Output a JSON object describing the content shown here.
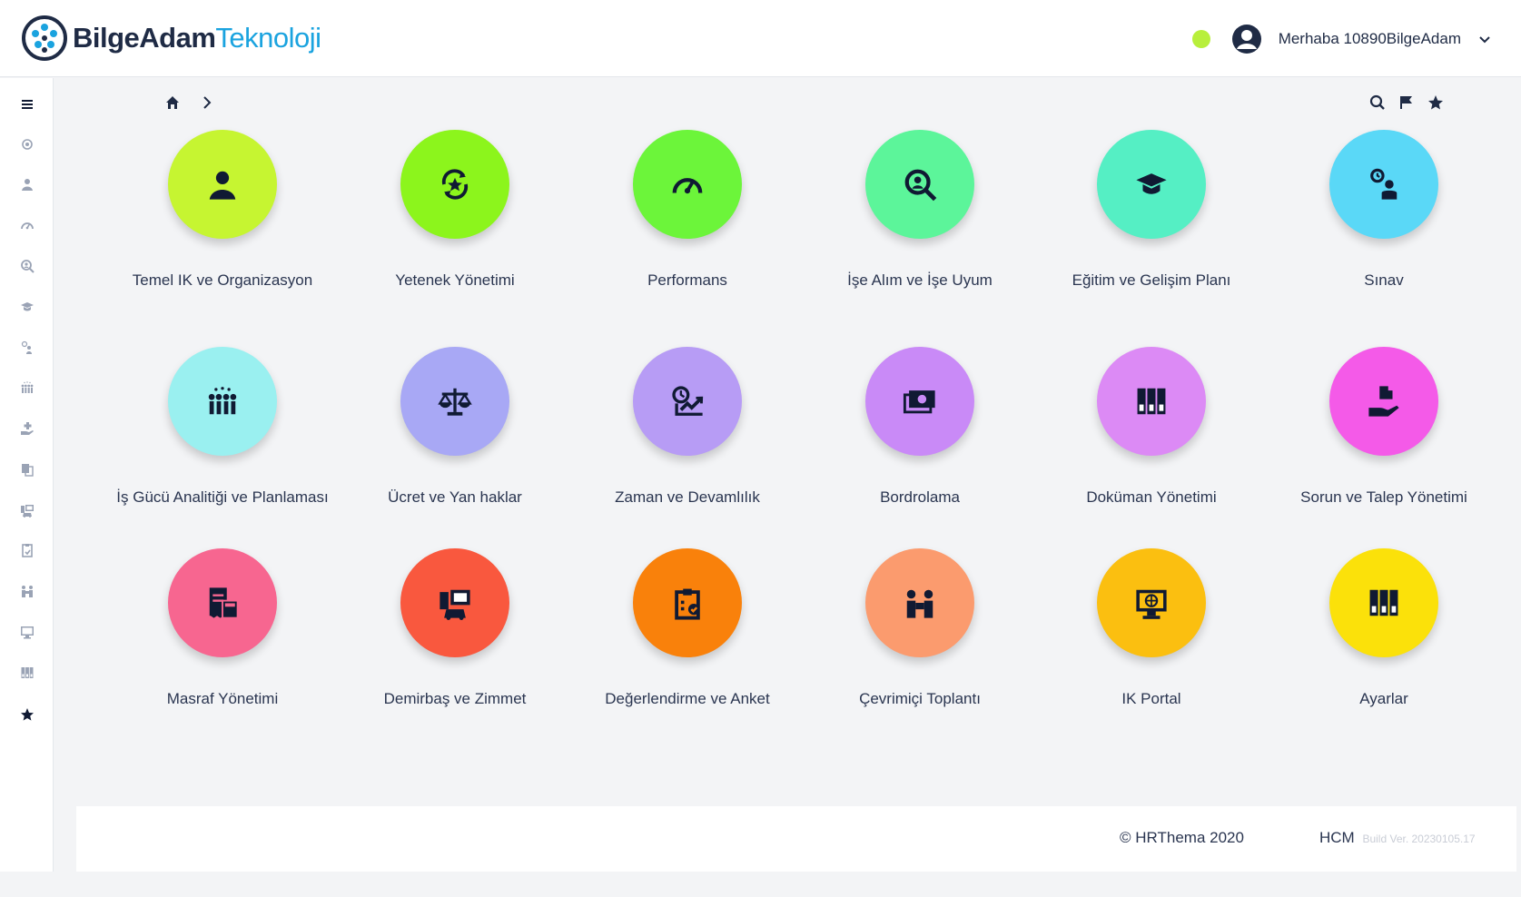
{
  "header": {
    "brand_part1": "BilgeAdam",
    "brand_part2": "Teknoloji",
    "greeting": "Merhaba 10890BilgeAdam",
    "status_color": "#b8ef3b"
  },
  "sidebar": {
    "items": [
      {
        "icon": "menu-icon"
      },
      {
        "icon": "settings-gear-icon"
      },
      {
        "icon": "user-icon"
      },
      {
        "icon": "speedometer-icon"
      },
      {
        "icon": "search-person-icon"
      },
      {
        "icon": "graduation-cap-icon"
      },
      {
        "icon": "exam-icon"
      },
      {
        "icon": "team-icon"
      },
      {
        "icon": "hand-plus-icon"
      },
      {
        "icon": "documents-icon"
      },
      {
        "icon": "assets-icon"
      },
      {
        "icon": "survey-icon"
      },
      {
        "icon": "meeting-icon"
      },
      {
        "icon": "monitor-icon"
      },
      {
        "icon": "binders-icon"
      },
      {
        "icon": "star-icon"
      }
    ]
  },
  "breadcrumb": {
    "home_icon": "home-icon",
    "separator_icon": "chevron-right-icon"
  },
  "toolbar": {
    "icons": [
      "search-icon",
      "flag-icon",
      "star-icon"
    ]
  },
  "modules": [
    {
      "label": "Temel IK ve Organizasyon",
      "color": "#c6f531",
      "icon": "user-icon"
    },
    {
      "label": "Yetenek Yönetimi",
      "color": "#8cf51c",
      "icon": "star-cycle-icon"
    },
    {
      "label": "Performans",
      "color": "#6cf53a",
      "icon": "speedometer-icon"
    },
    {
      "label": "İşe Alım ve İşe Uyum",
      "color": "#5cf59a",
      "icon": "search-person-icon"
    },
    {
      "label": "Eğitim ve Gelişim Planı",
      "color": "#55efc4",
      "icon": "graduation-cap-icon"
    },
    {
      "label": "Sınav",
      "color": "#5ad8f7",
      "icon": "exam-timer-icon"
    },
    {
      "label": "İş Gücü Analitiği ve Planlaması",
      "color": "#9af0f0",
      "icon": "team-icon"
    },
    {
      "label": "Ücret ve Yan haklar",
      "color": "#a8a8f5",
      "icon": "scales-icon"
    },
    {
      "label": "Zaman ve Devamlılık",
      "color": "#b79cf5",
      "icon": "time-trend-icon"
    },
    {
      "label": "Bordrolama",
      "color": "#c98af7",
      "icon": "money-stack-icon"
    },
    {
      "label": "Doküman Yönetimi",
      "color": "#dc8af5",
      "icon": "binders-icon"
    },
    {
      "label": "Sorun ve Talep Yönetimi",
      "color": "#f45ae8",
      "icon": "hand-puzzle-icon"
    },
    {
      "label": "Masraf Yönetimi",
      "color": "#f76690",
      "icon": "receipt-calculator-icon"
    },
    {
      "label": "Demirbaş ve Zimmet",
      "color": "#f9583e",
      "icon": "assets-icon"
    },
    {
      "label": "Değerlendirme ve Anket",
      "color": "#f9810b",
      "icon": "survey-clipboard-icon"
    },
    {
      "label": "Çevrimiçi Toplantı",
      "color": "#fb9b6e",
      "icon": "meeting-icon"
    },
    {
      "label": "IK Portal",
      "color": "#fbbf10",
      "icon": "monitor-globe-icon"
    },
    {
      "label": "Ayarlar",
      "color": "#fbe10a",
      "icon": "binders-icon"
    }
  ],
  "footer": {
    "copyright": "© HRThema 2020",
    "product": "HCM",
    "build": "Build Ver. 20230105.17"
  }
}
